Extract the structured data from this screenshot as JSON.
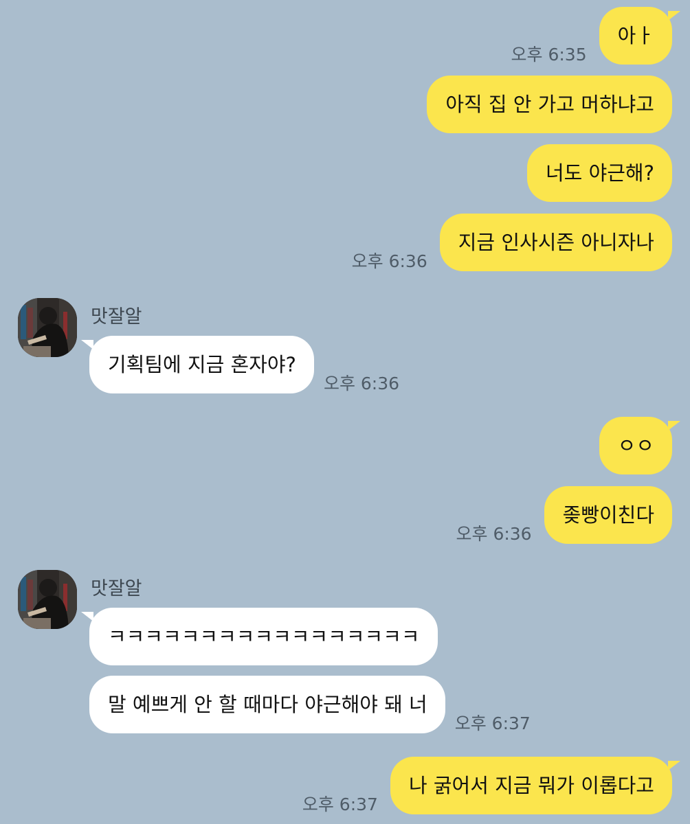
{
  "theme": {
    "background": "#aabdcd",
    "outgoing_bubble": "#fbe54d",
    "incoming_bubble": "#ffffff"
  },
  "messages": [
    {
      "direction": "out",
      "text": "아ㅏ",
      "time": "오후 6:35"
    },
    {
      "direction": "out",
      "text": "아직 집 안 가고 머하냐고",
      "time": ""
    },
    {
      "direction": "out",
      "text": "너도 야근해?",
      "time": ""
    },
    {
      "direction": "out",
      "text": "지금 인사시즌 아니자나",
      "time": "오후 6:36"
    },
    {
      "direction": "in",
      "sender": "맛잘알",
      "avatar_icon": "profile-photo",
      "text": "기획팀에 지금 혼자야?",
      "time": "오후 6:36"
    },
    {
      "direction": "out",
      "text": "ㅇㅇ",
      "time": ""
    },
    {
      "direction": "out",
      "text": "좆빵이친다",
      "time": "오후 6:36"
    },
    {
      "direction": "in",
      "sender": "맛잘알",
      "avatar_icon": "profile-photo",
      "text": "ㅋㅋㅋㅋㅋㅋㅋㅋㅋㅋㅋㅋㅋㅋㅋㅋㅋ",
      "time": ""
    },
    {
      "direction": "in",
      "text": "말 예쁘게 안 할 때마다 야근해야 돼 너",
      "time": "오후 6:37"
    },
    {
      "direction": "out",
      "text": "나 굵어서 지금 뭐가 이롭다고",
      "time": "오후 6:37"
    }
  ]
}
